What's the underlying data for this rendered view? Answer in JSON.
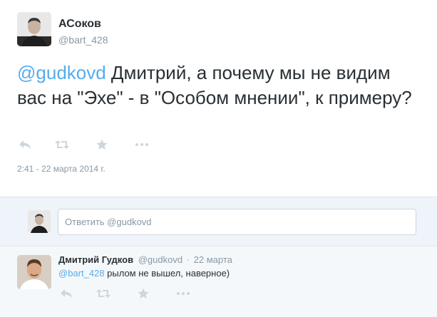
{
  "tweet": {
    "author_name": "АСоков",
    "author_handle": "@bart_428",
    "mention": "@gudkovd",
    "text": " Дмитрий, а почему мы не видим вас на \"Эхе\" - в \"Особом мнении\", к примеру?",
    "timestamp": "2:41 - 22 марта 2014 г.",
    "actions": [
      "reply-icon",
      "retweet-icon",
      "favorite-icon",
      "more-icon"
    ]
  },
  "reply_box": {
    "placeholder": "Ответить @gudkovd"
  },
  "reply": {
    "author_name": "Дмитрий Гудков",
    "author_handle": "@gudkovd",
    "separator": "·",
    "date": "22 марта",
    "mention": "@bart_428",
    "text": " рылом не вышел, наверное)",
    "actions": [
      "reply-icon",
      "retweet-icon",
      "favorite-icon",
      "more-icon"
    ]
  },
  "colors": {
    "link": "#55acee",
    "muted": "#8899a6",
    "text": "#292f33",
    "action_icon": "#ccd6dd"
  }
}
